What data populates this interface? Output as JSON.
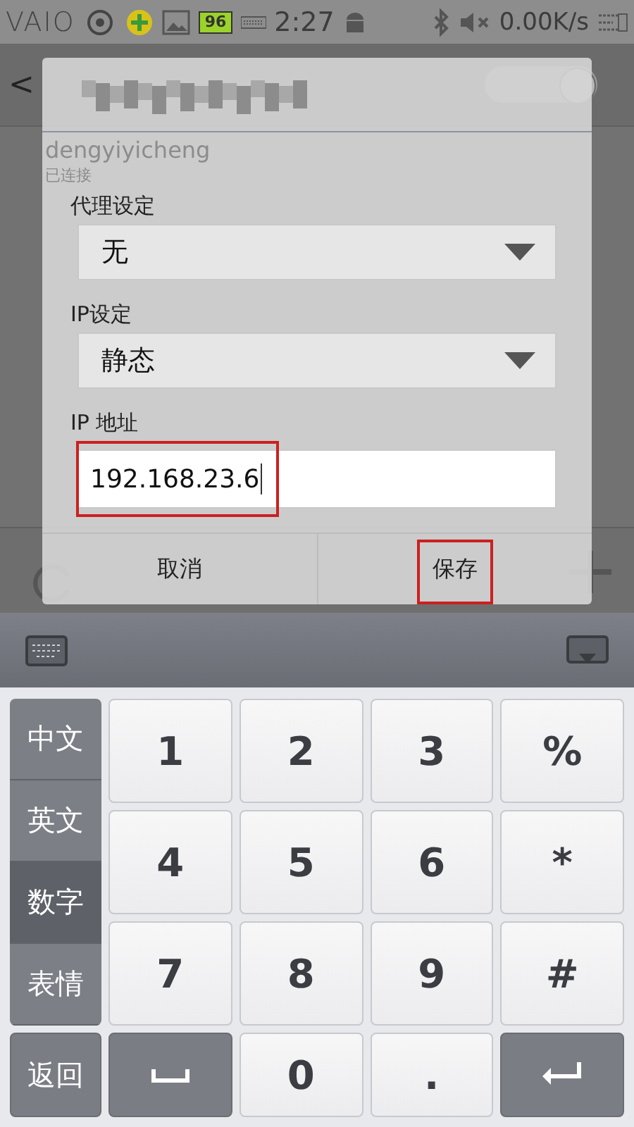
{
  "status_bar": {
    "logo": "VAIO",
    "battery": "96",
    "time": "2:27",
    "speed": "0.00K/s"
  },
  "background_screen": {
    "back": "<",
    "switch_on": true,
    "network_name": "dengyiyicheng",
    "network_status": "已连接"
  },
  "dialog": {
    "fields": [
      {
        "kind": "dropdown",
        "label": "代理设定",
        "value": "无",
        "highlighted": false
      },
      {
        "kind": "dropdown",
        "label": "IP设定",
        "value": "静态",
        "highlighted": false
      },
      {
        "kind": "text",
        "label": "IP 地址",
        "value": "192.168.23.6",
        "highlighted": true
      }
    ],
    "buttons": [
      {
        "label": "取消",
        "highlighted": false
      },
      {
        "label": "保存",
        "highlighted": true
      }
    ]
  },
  "keyboard": {
    "modes": [
      {
        "label": "中文",
        "selected": false
      },
      {
        "label": "英文",
        "selected": false
      },
      {
        "label": "数字",
        "selected": true
      },
      {
        "label": "表情",
        "selected": false
      }
    ],
    "keys": [
      {
        "kind": "char",
        "label": "1"
      },
      {
        "kind": "char",
        "label": "2"
      },
      {
        "kind": "char",
        "label": "3"
      },
      {
        "kind": "char",
        "label": "%"
      },
      {
        "kind": "char",
        "label": "4"
      },
      {
        "kind": "char",
        "label": "5"
      },
      {
        "kind": "char",
        "label": "6"
      },
      {
        "kind": "char",
        "label": "*"
      },
      {
        "kind": "char",
        "label": "7"
      },
      {
        "kind": "char",
        "label": "8"
      },
      {
        "kind": "char",
        "label": "9"
      },
      {
        "kind": "char",
        "label": "#"
      }
    ],
    "bottom_keys": [
      {
        "kind": "mode",
        "label": "返回"
      },
      {
        "kind": "space"
      },
      {
        "kind": "char",
        "label": "0"
      },
      {
        "kind": "char",
        "label": "."
      },
      {
        "kind": "enter"
      }
    ]
  }
}
